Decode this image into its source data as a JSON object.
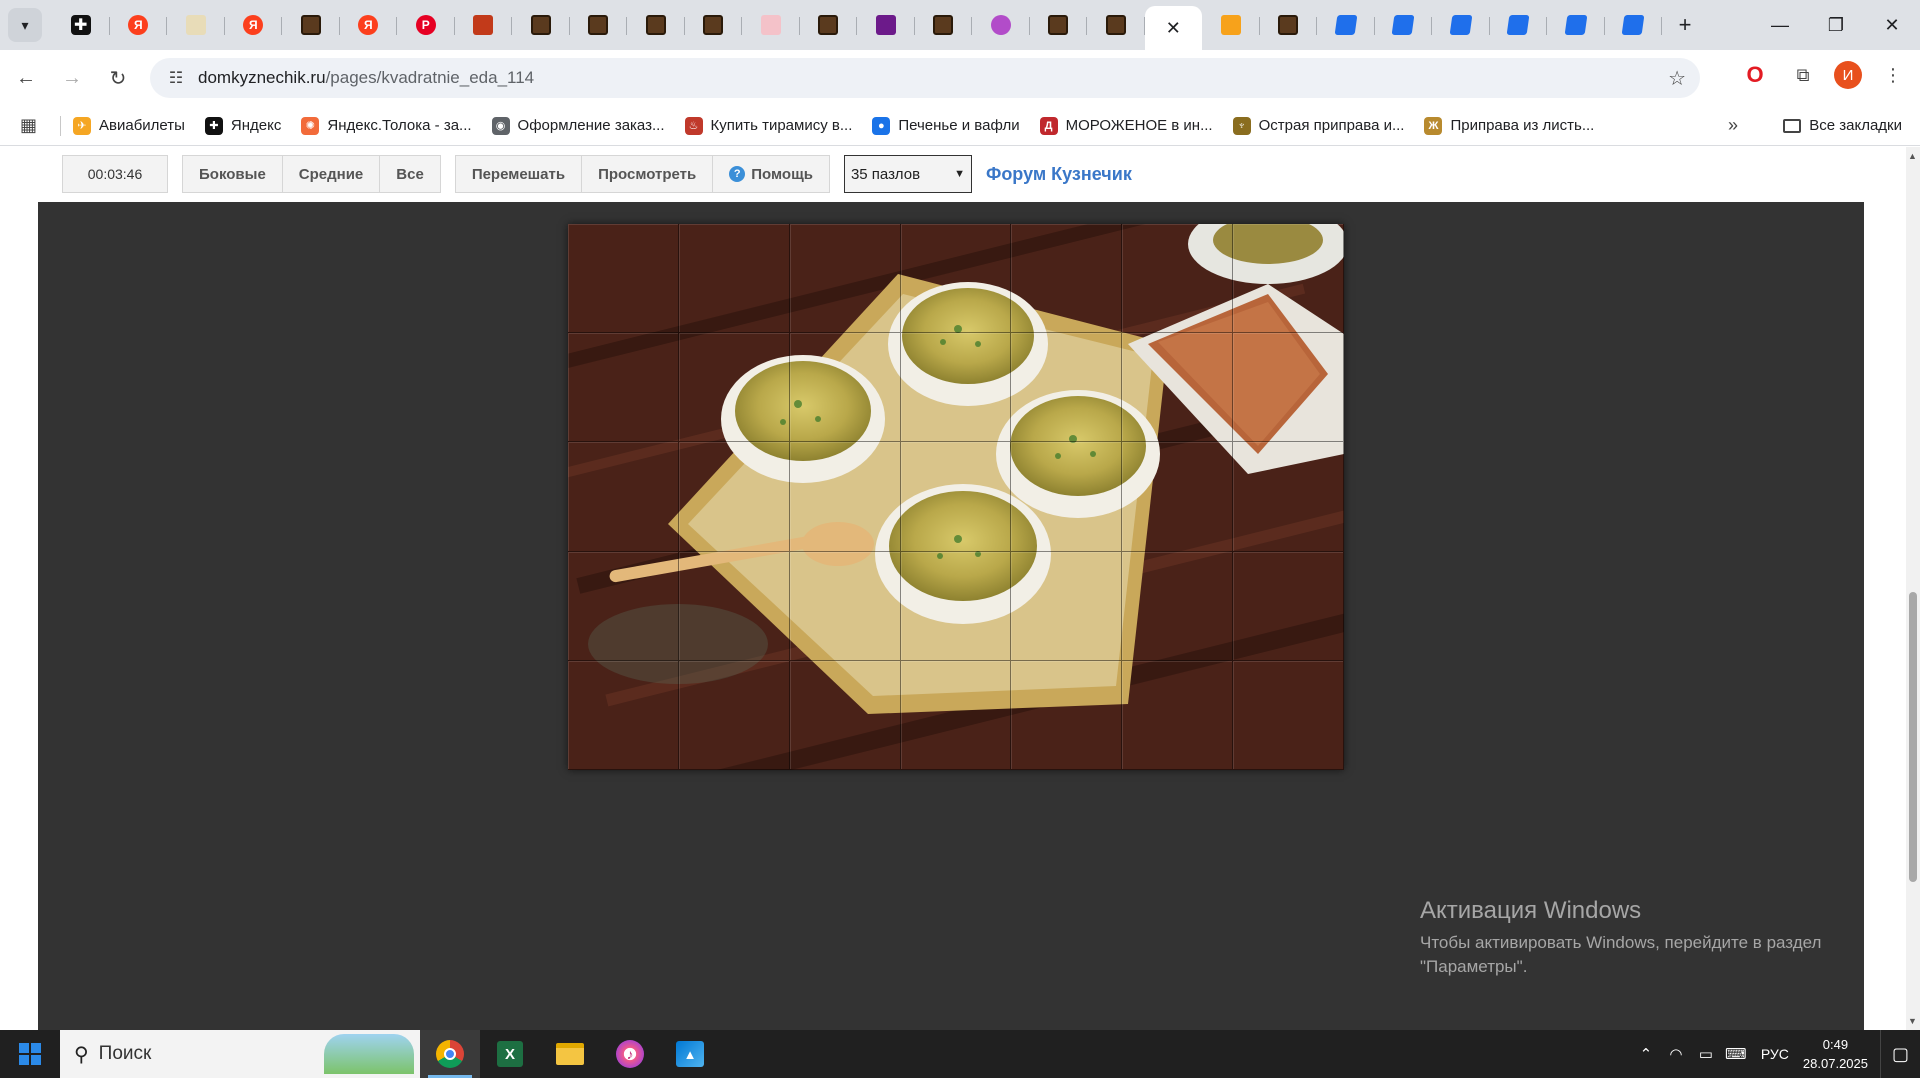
{
  "tabs": [
    {
      "icon": "plus-icon",
      "style": "plus",
      "glyph": "✚"
    },
    {
      "icon": "yandex-icon",
      "style": "ya",
      "glyph": "Я"
    },
    {
      "icon": "light-icon",
      "style": "light",
      "glyph": ""
    },
    {
      "icon": "yandex-icon",
      "style": "ya",
      "glyph": "Я"
    },
    {
      "icon": "bread-icon",
      "style": "bread",
      "glyph": ""
    },
    {
      "icon": "yandex-icon",
      "style": "ya",
      "glyph": "Я"
    },
    {
      "icon": "pinterest-icon",
      "style": "pin",
      "glyph": "P"
    },
    {
      "icon": "brush-icon",
      "style": "brush",
      "glyph": ""
    },
    {
      "icon": "bread-icon",
      "style": "bread",
      "glyph": ""
    },
    {
      "icon": "bread-icon",
      "style": "bread",
      "glyph": ""
    },
    {
      "icon": "bread-icon",
      "style": "bread",
      "glyph": ""
    },
    {
      "icon": "bread-icon",
      "style": "bread",
      "glyph": ""
    },
    {
      "icon": "cake-icon",
      "style": "cake",
      "glyph": ""
    },
    {
      "icon": "bread-icon",
      "style": "bread",
      "glyph": ""
    },
    {
      "icon": "grid-icon",
      "style": "grid",
      "glyph": ""
    },
    {
      "icon": "bread-icon",
      "style": "bread",
      "glyph": ""
    },
    {
      "icon": "picture-icon",
      "style": "pic",
      "glyph": ""
    },
    {
      "icon": "bread-icon",
      "style": "bread",
      "glyph": ""
    },
    {
      "icon": "bread-icon",
      "style": "bread",
      "glyph": ""
    },
    {
      "icon": "close-icon",
      "style": "active",
      "glyph": "✕"
    },
    {
      "icon": "mail-icon",
      "style": "mail",
      "glyph": ""
    },
    {
      "icon": "bread-icon",
      "style": "bread",
      "glyph": ""
    },
    {
      "icon": "blue-app-icon",
      "style": "blue",
      "glyph": ""
    },
    {
      "icon": "blue-app-icon",
      "style": "blue",
      "glyph": ""
    },
    {
      "icon": "blue-app-icon",
      "style": "blue",
      "glyph": ""
    },
    {
      "icon": "blue-app-icon",
      "style": "blue",
      "glyph": ""
    },
    {
      "icon": "blue-app-icon",
      "style": "blue",
      "glyph": ""
    },
    {
      "icon": "blue-app-icon",
      "style": "blue",
      "glyph": ""
    }
  ],
  "address": {
    "host": "domkyznechik.ru",
    "path": "/pages/kvadratnie_eda_114"
  },
  "profile": {
    "initial": "И"
  },
  "bookmarks": [
    {
      "label": "Авиабилеты",
      "icon": "plane-icon",
      "color": "#f5a623",
      "glyph": "✈"
    },
    {
      "label": "Яндекс",
      "icon": "plus-icon",
      "color": "#111111",
      "glyph": "✚"
    },
    {
      "label": "Яндекс.Толока - за...",
      "icon": "toloka-icon",
      "color": "#f26b3a",
      "glyph": "✺"
    },
    {
      "label": "Оформление заказ...",
      "icon": "globe-icon",
      "color": "#5f6368",
      "glyph": "◉"
    },
    {
      "label": "Купить тирамису в...",
      "icon": "cake-icon",
      "color": "#c0392b",
      "glyph": "♨"
    },
    {
      "label": "Печенье и вафли",
      "icon": "cookie-icon",
      "color": "#1a73e8",
      "glyph": "●"
    },
    {
      "label": "МОРОЖЕНОЕ в ин...",
      "icon": "shop-icon",
      "color": "#c0282d",
      "glyph": "Д"
    },
    {
      "label": "Острая приправа и...",
      "icon": "spice-icon",
      "color": "#8a6d1f",
      "glyph": "♆"
    },
    {
      "label": "Приправа из листь...",
      "icon": "herb-icon",
      "color": "#b88a2e",
      "glyph": "Ж"
    }
  ],
  "bookmarks_all": "Все закладки",
  "puzzle": {
    "timer": "00:03:46",
    "group1": [
      "Боковые",
      "Средние",
      "Все"
    ],
    "group2": [
      "Перемешать",
      "Просмотреть"
    ],
    "help": "Помощь",
    "select_value": "35 пазлов",
    "forum_link": "Форум Кузнечик",
    "grid": {
      "columns": 7,
      "rows": 5
    }
  },
  "activation": {
    "title": "Активация Windows",
    "line1": "Чтобы активировать Windows, перейдите в раздел",
    "line2": "\"Параметры\"."
  },
  "taskbar": {
    "search_placeholder": "Поиск",
    "lang": "РУС",
    "time": "0:49",
    "date": "28.07.2025"
  }
}
